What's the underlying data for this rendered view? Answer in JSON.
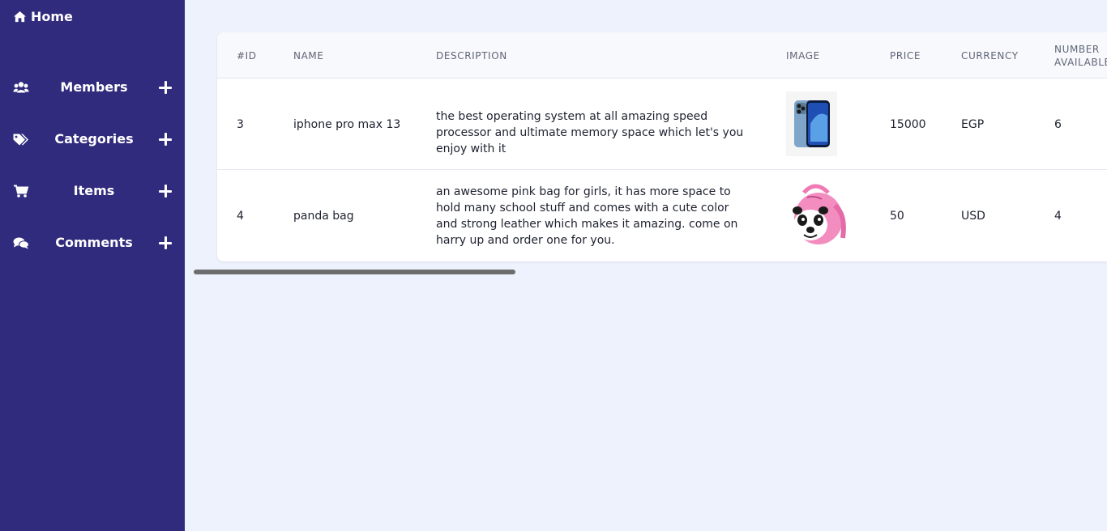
{
  "sidebar": {
    "home_label": "Home",
    "items": [
      {
        "label": "Members",
        "icon": "users-icon"
      },
      {
        "label": "Categories",
        "icon": "tags-icon"
      },
      {
        "label": "Items",
        "icon": "cart-icon"
      },
      {
        "label": "Comments",
        "icon": "comments-icon"
      }
    ]
  },
  "table": {
    "headers": [
      "#ID",
      "NAME",
      "DESCRIPTION",
      "IMAGE",
      "PRICE",
      "CURRENCY",
      "NUMBER AVAILABLE"
    ],
    "rows": [
      {
        "id": "3",
        "name": "iphone pro max 13",
        "description": "the best operating system at all amazing speed processor and ultimate memory space which let's you enjoy with it",
        "image": "iphone-image",
        "price": "15000",
        "currency": "EGP",
        "number_available": "6"
      },
      {
        "id": "4",
        "name": "panda bag",
        "description": "an awesome pink bag for girls, it has more space to hold many school stuff and comes with a cute color and strong leather which makes it amazing. come on harry up and order one for you.",
        "image": "panda-bag-image",
        "price": "50",
        "currency": "USD",
        "number_available": "4"
      }
    ]
  },
  "colors": {
    "sidebar_bg": "#312b7d",
    "page_bg": "#eef2fc",
    "scrollbar": "#6d6d6d"
  }
}
